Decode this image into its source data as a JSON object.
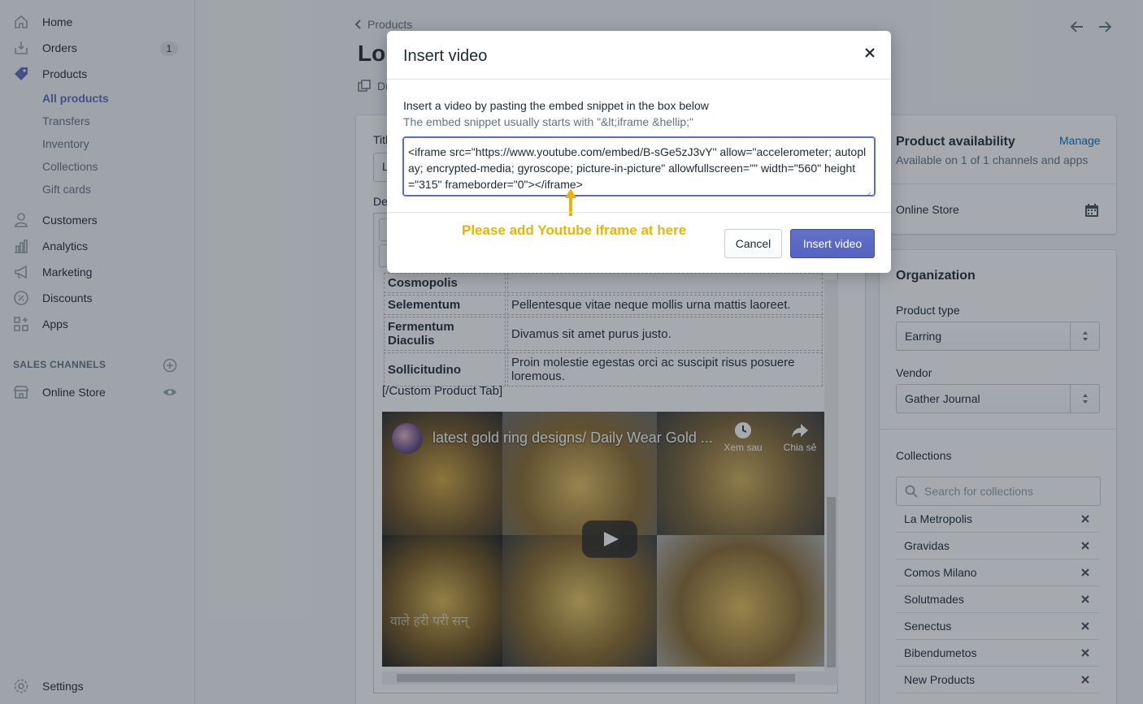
{
  "sidebar": {
    "items": [
      {
        "label": "Home",
        "icon": "home-icon"
      },
      {
        "label": "Orders",
        "icon": "orders-icon",
        "badge": "1"
      },
      {
        "label": "Products",
        "icon": "tag-icon"
      },
      {
        "label": "Customers",
        "icon": "person-icon"
      },
      {
        "label": "Analytics",
        "icon": "analytics-icon"
      },
      {
        "label": "Marketing",
        "icon": "megaphone-icon"
      },
      {
        "label": "Discounts",
        "icon": "discount-icon"
      },
      {
        "label": "Apps",
        "icon": "apps-icon"
      }
    ],
    "sub_items": [
      "All products",
      "Transfers",
      "Inventory",
      "Collections",
      "Gift cards"
    ],
    "sales_channels_header": "SALES CHANNELS",
    "online_store": "Online Store",
    "settings": "Settings"
  },
  "header": {
    "breadcrumb": "Products",
    "title": "Lor",
    "duplicate": "Du"
  },
  "product": {
    "title_label": "Titl",
    "title_value": "L",
    "description_label": "De"
  },
  "editor": {
    "table": [
      {
        "key": "Cosmopolis",
        "value": ""
      },
      {
        "key": "Selementum",
        "value": "Pellentesque vitae neque mollis urna mattis laoreet."
      },
      {
        "key": "Fermentum Diaculis",
        "value": "Divamus sit amet purus justo."
      },
      {
        "key": "Sollicitudino",
        "value": "Proin molestie egestas orci ac suscipit risus posuere loremous."
      }
    ],
    "custom_tab_close": "[/Custom Product Tab]",
    "video": {
      "title": "latest gold ring designs/ Daily Wear Gold ...",
      "watch_later": "Xem sau",
      "share": "Chia sẻ",
      "overlay_text": "वाले हरी परी सन्"
    }
  },
  "availability": {
    "title": "Product availability",
    "manage": "Manage",
    "subtitle": "Available on 1 of 1 channels and apps",
    "channel": "Online Store"
  },
  "organization": {
    "title": "Organization",
    "product_type_label": "Product type",
    "product_type_value": "Earring",
    "vendor_label": "Vendor",
    "vendor_value": "Gather Journal",
    "collections_label": "Collections",
    "collections_placeholder": "Search for collections",
    "collections": [
      "La Metropolis",
      "Gravidas",
      "Comos Milano",
      "Solutmades",
      "Senectus",
      "Bibendumetos",
      "New Products"
    ]
  },
  "modal": {
    "title": "Insert video",
    "hint": "Insert a video by pasting the embed snippet in the box below",
    "hint_sub": "The embed snippet usually starts with \"&lt;iframe &hellip;\"",
    "snippet": "<iframe src=\"https://www.youtube.com/embed/B-sGe5zJ3vY\" allow=\"accelerometer; autoplay; encrypted-media; gyroscope; picture-in-picture\" allowfullscreen=\"\" width=\"560\" height=\"315\" frameborder=\"0\"></iframe>",
    "annotation": "Please add Youtube iframe at here",
    "cancel": "Cancel",
    "insert": "Insert video"
  },
  "colors": {
    "accent": "#5c6ac4",
    "link": "#006fbb",
    "annotation": "#eab308"
  }
}
